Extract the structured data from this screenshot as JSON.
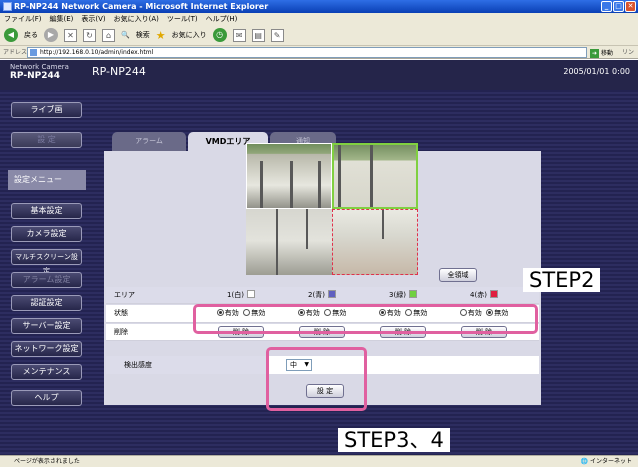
{
  "window": {
    "title": "RP-NP244 Network Camera - Microsoft Internet Explorer"
  },
  "menu": [
    "ファイル(F)",
    "編集(E)",
    "表示(V)",
    "お気に入り(A)",
    "ツール(T)",
    "ヘルプ(H)"
  ],
  "toolbar": {
    "back": "戻る",
    "search": "検索",
    "favorites": "お気に入り"
  },
  "address": {
    "label": "アドレス(D)",
    "url": "http://192.168.0.10/admin/index.html",
    "go": "移動",
    "links": "リンク"
  },
  "header": {
    "brand_small": "Network Camera",
    "brand_model": "RP-NP244",
    "model": "RP-NP244",
    "datetime": "2005/01/01  0:00"
  },
  "sidebar": {
    "live": "ライブ画",
    "setup": "設 定",
    "menu_title": "設定メニュー",
    "items": [
      "基本設定",
      "カメラ設定",
      "マルチスクリーン設定",
      "アラーム設定",
      "認証設定",
      "サーバー設定",
      "ネットワーク設定",
      "メンテナンス",
      "ヘルプ"
    ]
  },
  "tabs": [
    "アラーム",
    "VMDエリア",
    "通知"
  ],
  "vmd": {
    "all_area": "全領域",
    "area_label": "エリア",
    "state_label": "状態",
    "delete_label": "削除",
    "areas": [
      {
        "name": "1(白)",
        "color": "#ffffff",
        "enabled": true
      },
      {
        "name": "2(青)",
        "color": "#6060c0",
        "enabled": true
      },
      {
        "name": "3(緑)",
        "color": "#70d040",
        "enabled": true
      },
      {
        "name": "4(赤)",
        "color": "#e02040",
        "enabled": false
      }
    ],
    "enable": "有効",
    "disable": "無効",
    "delete_btn": "削 除",
    "sensitivity_label": "検出感度",
    "sensitivity_value": "中",
    "set_btn": "設 定"
  },
  "annotations": {
    "step2": "STEP2",
    "step34": "STEP3、4"
  },
  "status": {
    "text": "ページが表示されました",
    "zone": "インターネット"
  },
  "colors": {
    "header_bg": "#25254a",
    "panel_bg": "#d9d9e6",
    "highlight": "#e060a0"
  }
}
